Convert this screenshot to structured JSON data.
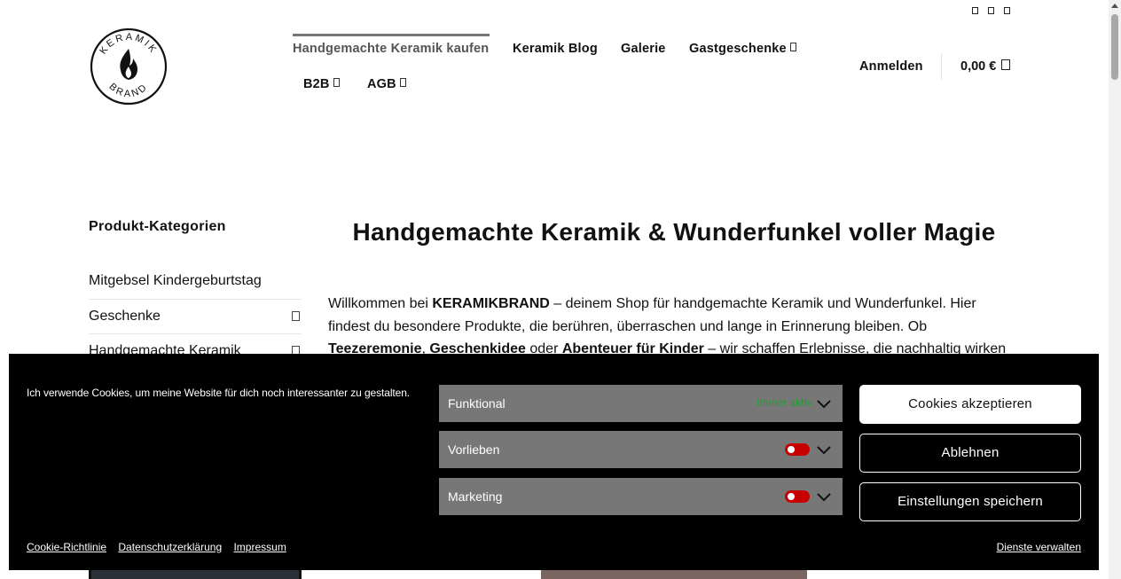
{
  "header": {
    "logo": {
      "top_text": "KERAMIK",
      "bottom_text": "BRAND"
    },
    "nav": [
      {
        "label": "Handgemachte Keramik kaufen",
        "active": true,
        "has_submenu": false
      },
      {
        "label": "Keramik Blog",
        "active": false,
        "has_submenu": false
      },
      {
        "label": "Galerie",
        "active": false,
        "has_submenu": false
      },
      {
        "label": "Gastgeschenke",
        "active": false,
        "has_submenu": true
      },
      {
        "label": "B2B",
        "active": false,
        "has_submenu": true
      },
      {
        "label": "AGB",
        "active": false,
        "has_submenu": true
      }
    ],
    "login_label": "Anmelden",
    "cart_total": "0,00 €",
    "top_icons": [
      "social-icon-1",
      "social-icon-2",
      "social-icon-3"
    ]
  },
  "sidebar": {
    "title": "Produkt-Kategorien",
    "categories": [
      {
        "label": "Mitgebsel Kindergeburtstag",
        "has_children": false
      },
      {
        "label": "Geschenke",
        "has_children": true
      },
      {
        "label": "Handgemachte Keramik",
        "has_children": true
      }
    ]
  },
  "main": {
    "headline": "Handgemachte Keramik & Wunderfunkel voller Magie",
    "intro": {
      "p1_start": "Willkommen bei ",
      "brand": "KERAMIKBRAND",
      "p1_rest": " – deinem Shop für handgemachte Keramik und Wunderfunkel. Hier findest du besondere Produkte, die berühren, überraschen und lange in Erinnerung bleiben. Ob ",
      "b1": "Teezeremonie",
      "sep1": ", ",
      "b2": "Geschenkidee",
      "sep2": " oder ",
      "b3": "Abenteuer für Kinder",
      "p1_end": " – wir schaffen Erlebnisse, die nachhaltig wirken"
    }
  },
  "cookie_banner": {
    "message": "Ich verwende Cookies, um meine Website für dich noch interessanter zu gestalten.",
    "categories": [
      {
        "name": "Funktional",
        "status": "Immer aktiv"
      },
      {
        "name": "Vorlieben",
        "enabled": false
      },
      {
        "name": "Marketing",
        "enabled": false
      }
    ],
    "buttons": {
      "accept": "Cookies akzeptieren",
      "deny": "Ablehnen",
      "save": "Einstellungen speichern"
    },
    "links": [
      "Cookie-Richtlinie",
      "Datenschutzerklärung",
      "Impressum"
    ],
    "manage": "Dienste verwalten",
    "colors": {
      "toggle_off": "#c60000",
      "always_active": "#1e9f2e",
      "row_bg": "#777777"
    }
  }
}
